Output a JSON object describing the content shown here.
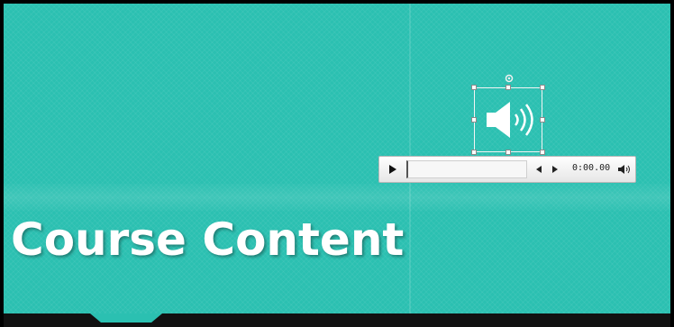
{
  "slide": {
    "title": "Course Content",
    "background_color": "#2bc0b1"
  },
  "audio_icon": {
    "icon": "speaker-icon",
    "rotate_icon": "rotate-handle-icon"
  },
  "player": {
    "play_icon": "play-icon",
    "skip_back_icon": "skip-back-icon",
    "skip_forward_icon": "skip-forward-icon",
    "time": "0:00.00",
    "volume_icon": "volume-icon",
    "progress": 0
  }
}
